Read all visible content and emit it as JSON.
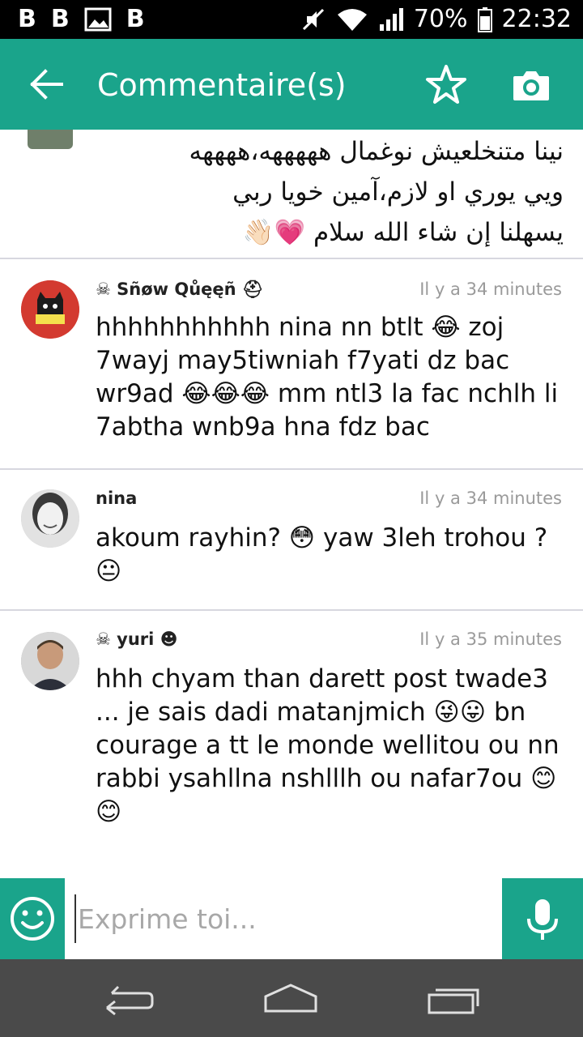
{
  "status_bar": {
    "left_icons": [
      "B",
      "B",
      "image-icon",
      "B"
    ],
    "battery": "70%",
    "time": "22:32"
  },
  "app_bar": {
    "title": "Commentaire(s)",
    "color": "#1aa48b"
  },
  "previous_comment": {
    "lines": [
      "نينا متنخلعيش نوغمال هههههه،ههههه",
      "ويي يوري او لازم،آمين خويا ربي",
      "يسهلنا إن شاء الله سلام 💗👋🏻"
    ]
  },
  "comments": [
    {
      "author": "Sñøw Qůęęñ",
      "time": "Il y a 34 minutes",
      "text": "hhhhhhhhhhh nina nn btlt 😂 zoj 7wayj may5tiwniah f7yati dz bac wr9ad 😂😂😂 mm ntl3 la fac nchlh li 7abtha wnb9a hna fdz bac"
    },
    {
      "author": "nina",
      "time": "Il y a 34 minutes",
      "text": "akoum rayhin? 😳 yaw 3leh trohou ? 😐"
    },
    {
      "author": "yuri",
      "time": "Il y a 35 minutes",
      "text": "hhh chyam than darett post twade3 ... je sais dadi matanjmich 😜😛 bn courage a tt le monde wellitou ou nn rabbi ysahllna nshlllh ou nafar7ou 😊😊"
    }
  ],
  "input": {
    "placeholder": "Exprime toi..."
  },
  "icons": [
    "back-arrow-icon",
    "star-icon",
    "camera-icon",
    "smiley-icon",
    "microphone-icon",
    "back-nav-icon",
    "home-nav-icon",
    "recents-nav-icon"
  ]
}
